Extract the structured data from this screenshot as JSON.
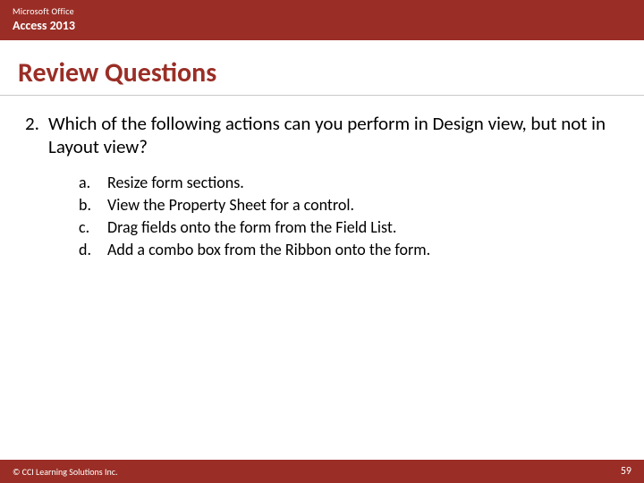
{
  "header": {
    "brand_line1": "Microsoft Office",
    "brand_line2": "Access 2013"
  },
  "title": "Review Questions",
  "question": {
    "number": "2.",
    "text": "Which of the following actions can you perform in Design view, but not in Layout view?",
    "options": [
      {
        "letter": "a.",
        "text": "Resize form sections."
      },
      {
        "letter": "b.",
        "text": "View the Property Sheet for a control."
      },
      {
        "letter": "c.",
        "text": "Drag fields onto the form from the Field List."
      },
      {
        "letter": "d.",
        "text": "Add a combo box from the Ribbon onto the form."
      }
    ]
  },
  "footer": {
    "copyright": "© CCI Learning Solutions Inc.",
    "page": "59"
  }
}
